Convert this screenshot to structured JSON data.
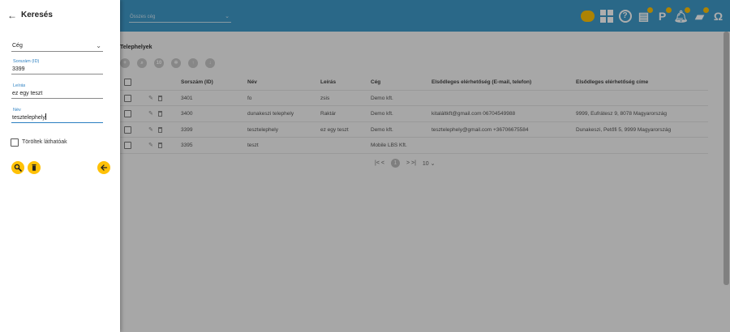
{
  "topbar": {
    "company_placeholder": "Összes cég",
    "icons": [
      "package-icon",
      "dashboard-grid-icon",
      "help-icon",
      "report-icon",
      "parking-icon",
      "bell-icon",
      "chat-icon",
      "headset-icon"
    ],
    "accent_color": "#3f9ac9",
    "badge_color": "#ffc107"
  },
  "main": {
    "title": "Telephelyek",
    "toolbar_icons": [
      "add-icon",
      "search-icon",
      "export-csv-icon",
      "settings-icon",
      "upload-icon",
      "download-icon"
    ],
    "toolbar_csv_label": "10",
    "columns": [
      "Sorszám (ID)",
      "Név",
      "Leírás",
      "Cég",
      "Elsődleges elérhetőség (E-mail, telefon)",
      "Elsődleges elérhetőség címe"
    ],
    "rows": [
      {
        "id": "3401",
        "name": "fo",
        "desc": "zsis",
        "company": "Demo kft.",
        "contact": "",
        "address": ""
      },
      {
        "id": "3400",
        "name": "dunakeszi telephely",
        "desc": "Raktár",
        "company": "Demo kft.",
        "contact": "kitaláltkft@gmail.com 06704549988",
        "address": "9999, Eufrátesz 9, 8078 Magyarország"
      },
      {
        "id": "3399",
        "name": "tesztelephely",
        "desc": "ez egy teszt",
        "company": "Demo kft.",
        "contact": "tesztelephely@gmail.com +36706675584",
        "address": "Dunakeszi, Petőfi 5, 9999 Magyarország"
      },
      {
        "id": "3395",
        "name": "teszt",
        "desc": "",
        "company": "Mobile LBS Kft.",
        "contact": "",
        "address": ""
      }
    ],
    "pager": {
      "nav": "|< <",
      "current_page": "1",
      "nav_next": "> >|",
      "page_size": "10 ⌄"
    }
  },
  "drawer": {
    "title": "Keresés",
    "company_select_value": "Cég",
    "fields": [
      {
        "label": "Sorszám (ID)",
        "value": "3399"
      },
      {
        "label": "Leírás",
        "value": "ez egy teszt"
      },
      {
        "label": "Név",
        "value": "tesztelephely"
      }
    ],
    "checkbox_label": "Töröltek láthatóak"
  }
}
